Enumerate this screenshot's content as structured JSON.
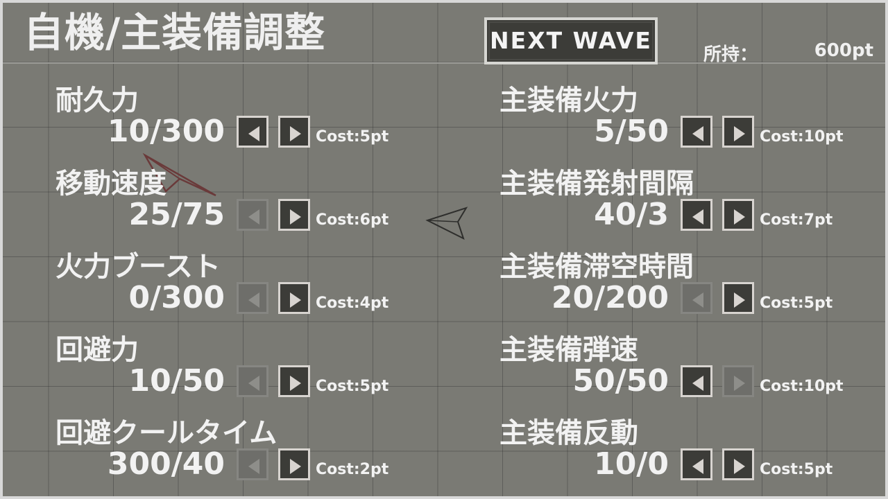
{
  "header": {
    "title": "自機/主装備調整",
    "next_wave_label": "NEXT WAVE",
    "points_label": "所持：",
    "points_value": "600pt"
  },
  "stats_left": [
    {
      "label": "耐久力",
      "value": "10/300",
      "cost": "Cost:5pt",
      "dec_enabled": true,
      "inc_enabled": true
    },
    {
      "label": "移動速度",
      "value": "25/75",
      "cost": "Cost:6pt",
      "dec_enabled": false,
      "inc_enabled": true
    },
    {
      "label": "火力ブースト",
      "value": "0/300",
      "cost": "Cost:4pt",
      "dec_enabled": false,
      "inc_enabled": true
    },
    {
      "label": "回避力",
      "value": "10/50",
      "cost": "Cost:5pt",
      "dec_enabled": false,
      "inc_enabled": true
    },
    {
      "label": "回避クールタイム",
      "value": "300/40",
      "cost": "Cost:2pt",
      "dec_enabled": false,
      "inc_enabled": true
    }
  ],
  "stats_right": [
    {
      "label": "主装備火力",
      "value": "5/50",
      "cost": "Cost:10pt",
      "dec_enabled": true,
      "inc_enabled": true
    },
    {
      "label": "主装備発射間隔",
      "value": "40/3",
      "cost": "Cost:7pt",
      "dec_enabled": true,
      "inc_enabled": true
    },
    {
      "label": "主装備滞空時間",
      "value": "20/200",
      "cost": "Cost:5pt",
      "dec_enabled": false,
      "inc_enabled": true
    },
    {
      "label": "主装備弾速",
      "value": "50/50",
      "cost": "Cost:10pt",
      "dec_enabled": true,
      "inc_enabled": false
    },
    {
      "label": "主装備反動",
      "value": "10/0",
      "cost": "Cost:5pt",
      "dec_enabled": true,
      "inc_enabled": true
    }
  ],
  "icons": {
    "decrease": "left-arrow-icon",
    "increase": "right-arrow-icon",
    "player_ship": "player-ship-icon",
    "enemy_ship": "enemy-ship-icon"
  },
  "colors": {
    "background": "#7a7a74",
    "text": "#f2f2f2",
    "button_bg": "#3c3c38",
    "button_border": "#d8d4d0",
    "disabled_button": "#6e6e6a"
  }
}
